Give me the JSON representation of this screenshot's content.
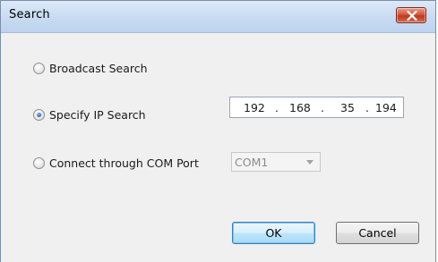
{
  "window": {
    "title": "Search"
  },
  "options": {
    "broadcast_label": "Broadcast Search",
    "specify_ip_label": "Specify IP Search",
    "com_port_label": "Connect through COM Port",
    "selected": "specify_ip"
  },
  "ip_address": {
    "octet1": "192",
    "octet2": "168",
    "octet3": "35",
    "octet4": "194",
    "separator": "."
  },
  "com_port": {
    "value": "COM1"
  },
  "buttons": {
    "ok": "OK",
    "cancel": "Cancel"
  },
  "icons": {
    "close": "close-icon",
    "dropdown": "chevron-down-icon"
  },
  "colors": {
    "titlebar": "#c8dbf2",
    "close_button": "#c0391d",
    "default_button_border": "#3c7fb1"
  }
}
